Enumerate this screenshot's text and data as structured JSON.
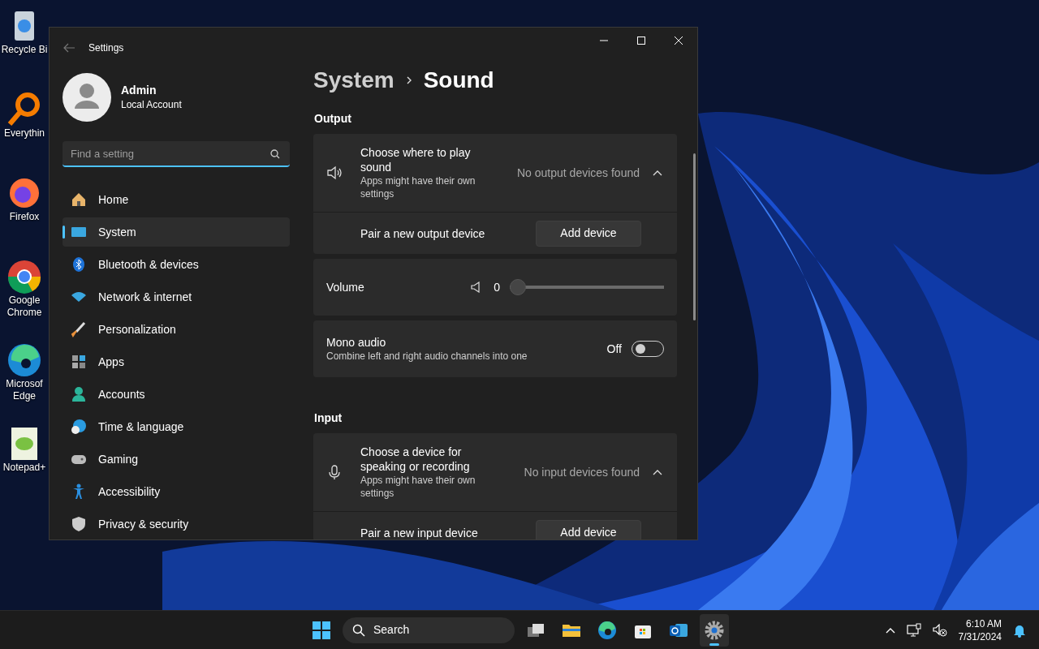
{
  "desktop_icons": [
    {
      "lines": [
        "Recycle Bi"
      ]
    },
    {
      "lines": [
        "Everythin"
      ]
    },
    {
      "lines": [
        "Firefox"
      ]
    },
    {
      "lines": [
        "Google",
        "Chrome"
      ]
    },
    {
      "lines": [
        "Microsof",
        "Edge"
      ]
    },
    {
      "lines": [
        "Notepad+"
      ]
    }
  ],
  "window": {
    "title": "Settings"
  },
  "account": {
    "name": "Admin",
    "type": "Local Account"
  },
  "search": {
    "placeholder": "Find a setting"
  },
  "nav": [
    {
      "label": "Home",
      "selected": false
    },
    {
      "label": "System",
      "selected": true
    },
    {
      "label": "Bluetooth & devices",
      "selected": false
    },
    {
      "label": "Network & internet",
      "selected": false
    },
    {
      "label": "Personalization",
      "selected": false
    },
    {
      "label": "Apps",
      "selected": false
    },
    {
      "label": "Accounts",
      "selected": false
    },
    {
      "label": "Time & language",
      "selected": false
    },
    {
      "label": "Gaming",
      "selected": false
    },
    {
      "label": "Accessibility",
      "selected": false
    },
    {
      "label": "Privacy & security",
      "selected": false
    }
  ],
  "breadcrumb": {
    "parent": "System",
    "current": "Sound"
  },
  "sections": [
    {
      "heading": "Output",
      "cards": [
        {
          "kind": "expander",
          "title": "Choose where to play sound",
          "subtitle": "Apps might have their own settings",
          "status": "No output devices found",
          "expanded": true,
          "sub_label": "Pair a new output device",
          "button": "Add device"
        },
        {
          "kind": "slider",
          "title": "Volume",
          "reading": "0",
          "level": 0
        },
        {
          "kind": "toggle",
          "title": "Mono audio",
          "subtitle": "Combine left and right audio channels into one",
          "state_label": "Off",
          "on": false
        }
      ]
    },
    {
      "heading": "Input",
      "cards": [
        {
          "kind": "expander",
          "title": "Choose a device for speaking or recording",
          "subtitle": "Apps might have their own settings",
          "status": "No input devices found",
          "expanded": true,
          "sub_label": "Pair a new input device",
          "button": "Add device"
        }
      ]
    }
  ],
  "taskbar": {
    "search_placeholder": "Search",
    "apps": [
      {
        "running": false
      },
      {
        "running": false
      },
      {
        "running": false
      },
      {
        "running": false
      },
      {
        "running": false
      },
      {
        "running": true
      }
    ],
    "time": "6:10 AM",
    "date": "7/31/2024"
  }
}
